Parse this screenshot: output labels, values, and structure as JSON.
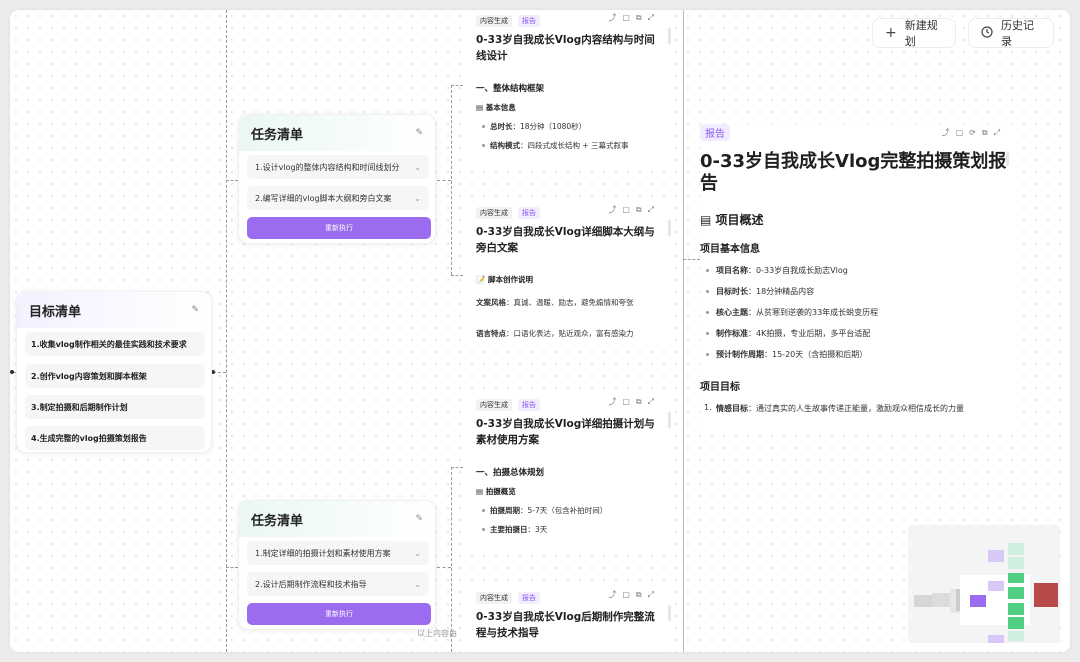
{
  "toolbar": {
    "new_plan": "新建规划",
    "new_plan_icon": "plus-icon",
    "history": "历史记录",
    "history_icon": "clock-icon"
  },
  "goals": {
    "title": "目标清单",
    "items": [
      "1.收集vlog制作相关的最佳实践和技术要求",
      "2.创作vlog内容策划和脚本框架",
      "3.制定拍摄和后期制作计划",
      "4.生成完整的vlog拍摄策划报告"
    ]
  },
  "task_lists": [
    {
      "title": "任务清单",
      "items": [
        "1.设计vlog的整体内容结构和时间线划分",
        "2.编写详细的vlog脚本大纲和旁白文案"
      ],
      "run_label": "重新执行"
    },
    {
      "title": "任务清单",
      "items": [
        "1.制定详细的拍摄计划和素材使用方案",
        "2.设计后期制作流程和技术指导"
      ],
      "run_label": "重新执行"
    }
  ],
  "docs": [
    {
      "tag_a": "内容生成",
      "tag_b": "报告",
      "title": "0-33岁自我成长Vlog内容结构与时间线设计",
      "h": "一、整体结构框架",
      "sub": "基本信息",
      "items": [
        {
          "k": "总时长",
          "v": "：18分钟（1080秒）"
        },
        {
          "k": "结构模式",
          "v": "：四段式成长结构 + 三幕式叙事"
        }
      ]
    },
    {
      "tag_a": "内容生成",
      "tag_b": "报告",
      "title": "0-33岁自我成长Vlog详细脚本大纲与旁白文案",
      "sub": "脚本创作说明",
      "paras": [
        {
          "k": "文案风格",
          "v": "：真诚、温暖、励志，避免煽情和夸张"
        },
        {
          "k": "语言特点",
          "v": "：口语化表达，贴近观众，富有感染力"
        }
      ]
    },
    {
      "tag_a": "内容生成",
      "tag_b": "报告",
      "title": "0-33岁自我成长Vlog详细拍摄计划与素材使用方案",
      "h": "一、拍摄总体规划",
      "sub": "拍摄概览",
      "items": [
        {
          "k": "拍摄周期",
          "v": "：5-7天（包含补拍时间）"
        },
        {
          "k": "主要拍摄日",
          "v": "：3天"
        }
      ]
    },
    {
      "tag_a": "内容生成",
      "tag_b": "报告",
      "title": "0-33岁自我成长Vlog后期制作完整流程与技术指导"
    }
  ],
  "footer_hint": "以上内容由",
  "report": {
    "tag": "报告",
    "title": "0-33岁自我成长Vlog完整拍摄策划报告",
    "section": "项目概述",
    "sub1": "项目基本信息",
    "items": [
      {
        "k": "项目名称",
        "v": "：0-33岁自我成长励志Vlog"
      },
      {
        "k": "目标时长",
        "v": "：18分钟精品内容"
      },
      {
        "k": "核心主题",
        "v": "：从贫寒到逆袭的33年成长蜕变历程"
      },
      {
        "k": "制作标准",
        "v": "：4K拍摄，专业后期，多平台适配"
      },
      {
        "k": "预计制作周期",
        "v": "：15-20天（含拍摄和后期）"
      }
    ],
    "sub2": "项目目标",
    "goals": [
      {
        "n": "1.",
        "k": "情感目标",
        "v": "：通过真实的人生故事传递正能量，激励观众相信成长的力量"
      }
    ]
  },
  "colors": {
    "accent": "#9b6cf0",
    "tag_bg": "#f2ecff",
    "minimap_green": "#4fcf7f",
    "minimap_red": "#b84a4a"
  }
}
